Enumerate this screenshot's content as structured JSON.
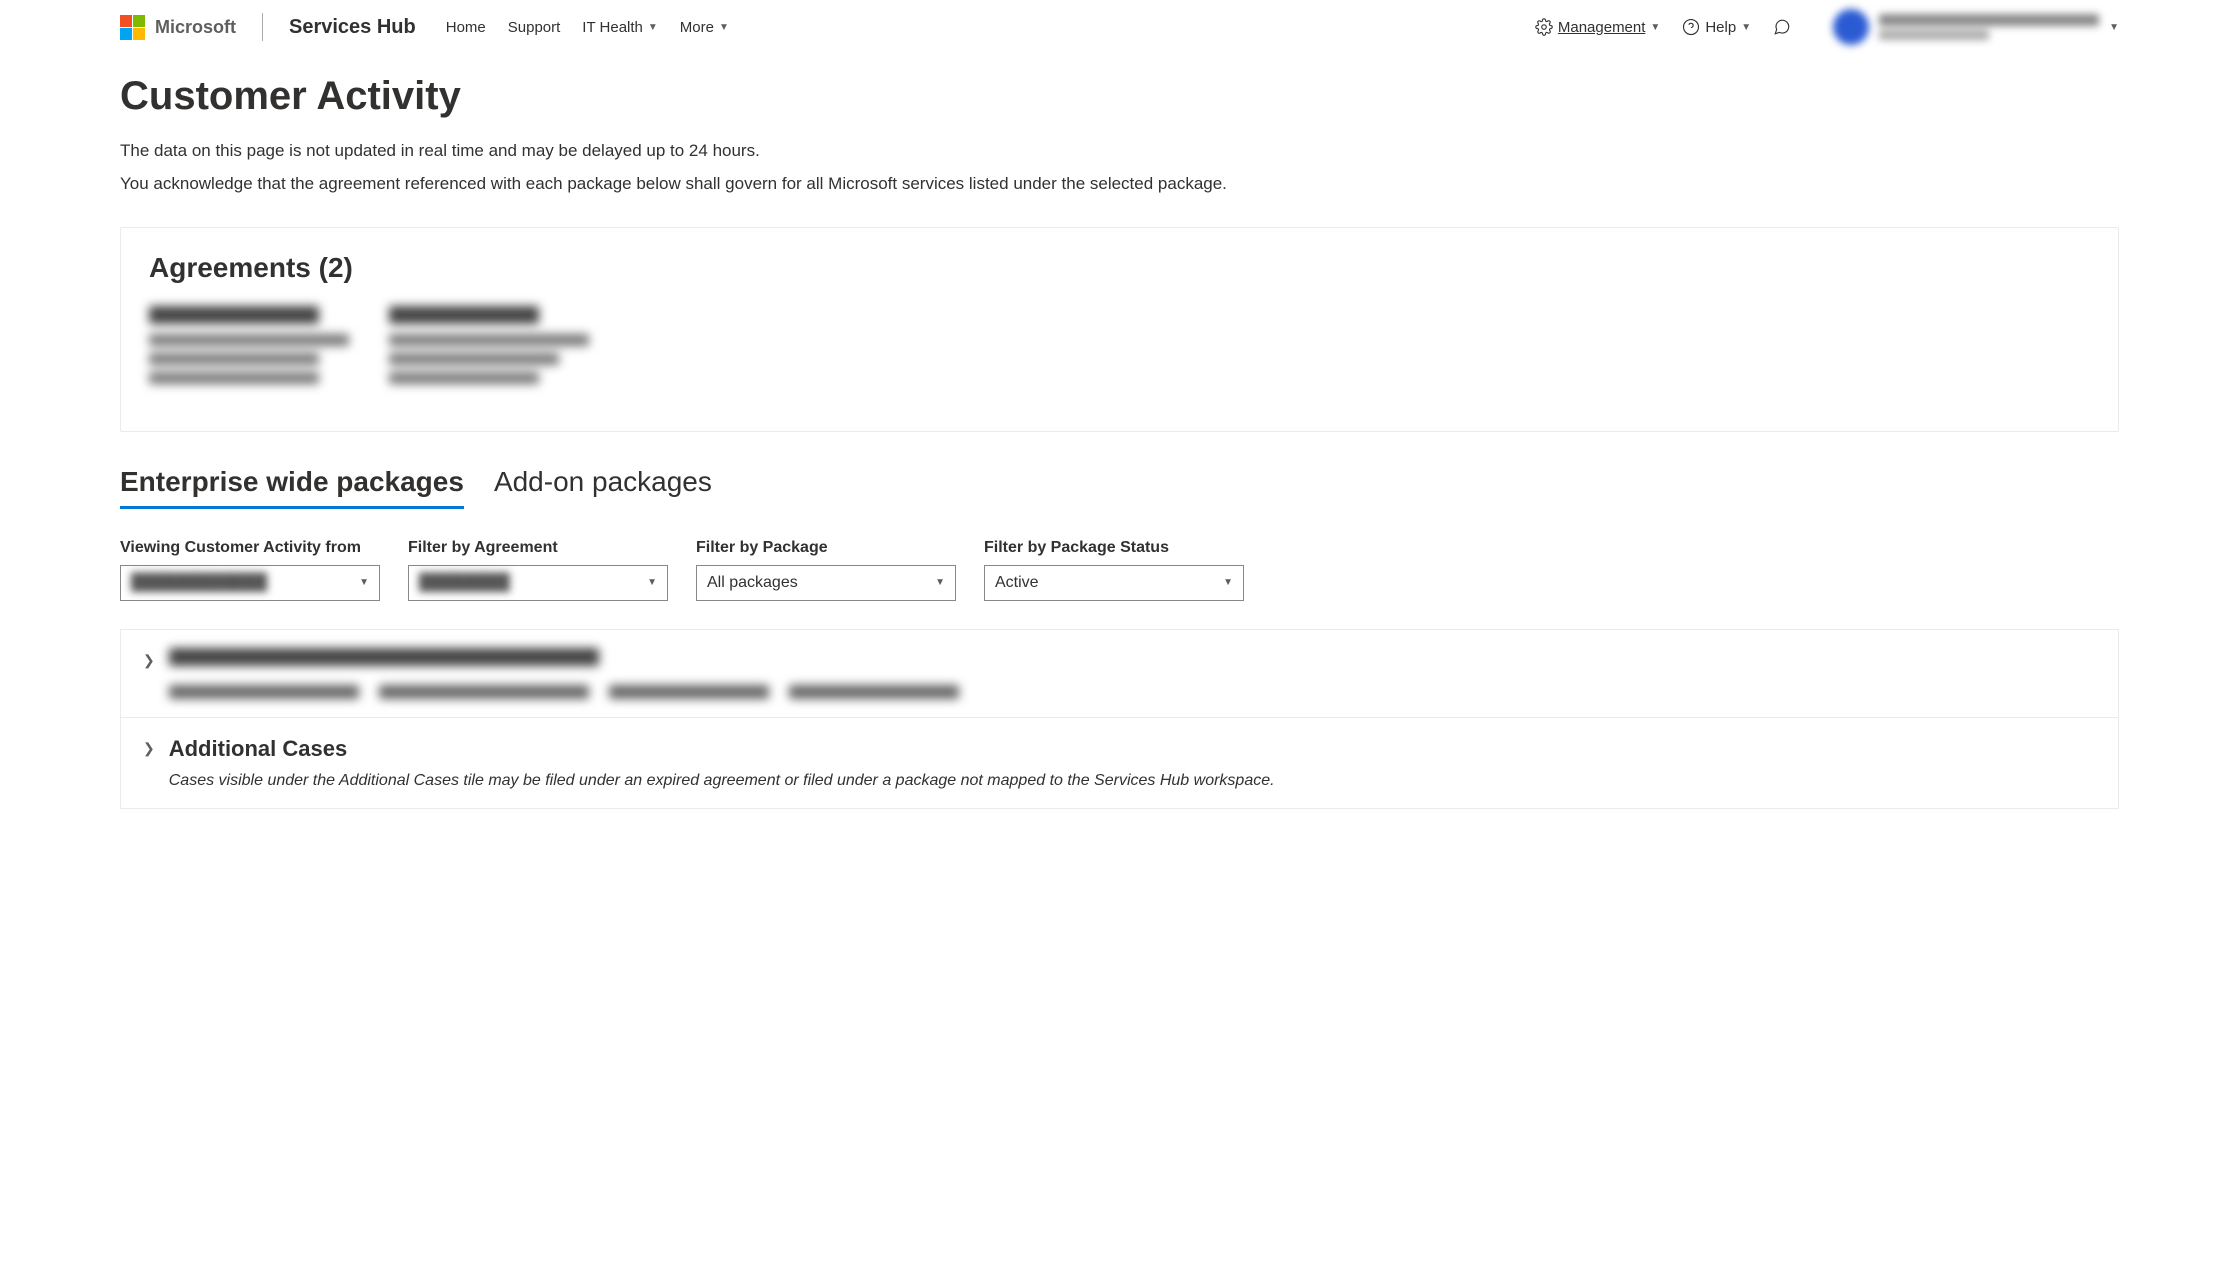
{
  "header": {
    "brand": "Microsoft",
    "app_title": "Services Hub",
    "nav": {
      "home": "Home",
      "support": "Support",
      "it_health": "IT Health",
      "more": "More",
      "management": "Management",
      "help": "Help"
    }
  },
  "page": {
    "title": "Customer Activity",
    "desc_line1": "The data on this page is not updated in real time and may be delayed up to 24 hours.",
    "desc_line2": "You acknowledge that the agreement referenced with each package below shall govern for all Microsoft services listed under the selected package."
  },
  "agreements_card": {
    "title": "Agreements (2)"
  },
  "tabs": {
    "enterprise": "Enterprise wide packages",
    "addon": "Add-on packages"
  },
  "filters": {
    "viewing_from": {
      "label": "Viewing Customer Activity from",
      "value": ""
    },
    "by_agreement": {
      "label": "Filter by Agreement",
      "value": ""
    },
    "by_package": {
      "label": "Filter by Package",
      "value": "All packages"
    },
    "by_status": {
      "label": "Filter by Package Status",
      "value": "Active"
    }
  },
  "packages": {
    "additional_cases": {
      "title": "Additional Cases",
      "note": "Cases visible under the Additional Cases tile may be filed under an expired agreement or filed under a package not mapped to the Services Hub workspace."
    }
  }
}
